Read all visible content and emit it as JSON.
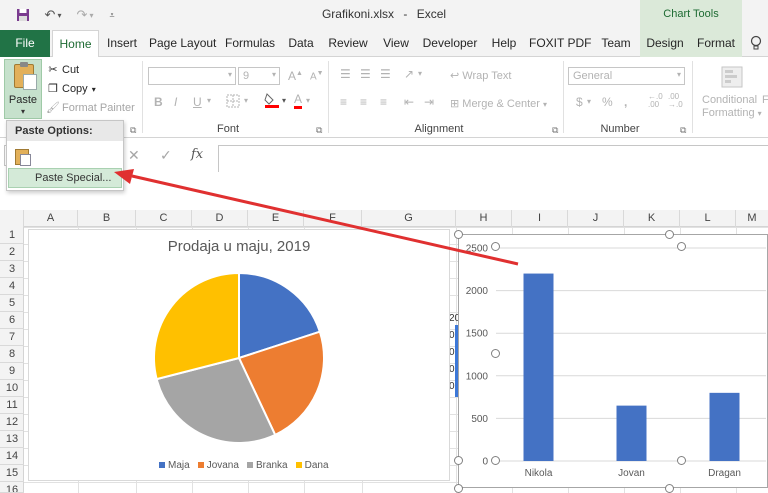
{
  "window": {
    "file_name": "Grafikoni.xlsx",
    "separator": "-",
    "app_name": "Excel",
    "contextual_group": "Chart Tools"
  },
  "qat": {
    "icons": [
      "save-icon",
      "undo-icon",
      "redo-icon",
      "customize-qat-icon"
    ]
  },
  "tabs": [
    {
      "label": "File"
    },
    {
      "label": "Home",
      "active": true
    },
    {
      "label": "Insert"
    },
    {
      "label": "Page Layout"
    },
    {
      "label": "Formulas"
    },
    {
      "label": "Data"
    },
    {
      "label": "Review"
    },
    {
      "label": "View"
    },
    {
      "label": "Developer"
    },
    {
      "label": "Help"
    },
    {
      "label": "FOXIT PDF"
    },
    {
      "label": "Team"
    },
    {
      "label": "Design",
      "contextual": true
    },
    {
      "label": "Format",
      "contextual": true
    }
  ],
  "ribbon": {
    "clipboard": {
      "paste": "Paste",
      "cut": "Cut",
      "copy": "Copy",
      "format_painter": "Format Painter"
    },
    "font": {
      "label": "Font",
      "size": "9",
      "grow": "A",
      "shrink": "A",
      "bold": "B",
      "italic": "I",
      "underline": "U",
      "font_color": "A"
    },
    "alignment": {
      "label": "Alignment",
      "wrap_text": "Wrap Text",
      "merge_center": "Merge & Center"
    },
    "number": {
      "label": "Number",
      "format": "General",
      "currency": "$",
      "percent": "%",
      "comma": ","
    },
    "styles": {
      "conditional_formatting_1": "Conditional",
      "conditional_formatting_2": "Formatting",
      "cutoff": "F"
    }
  },
  "paste_menu": {
    "header": "Paste Options:",
    "paste_special": "Paste Special..."
  },
  "formula_bar": {
    "fx": "fx",
    "cancel": "✕",
    "enter": "✓"
  },
  "columns": [
    "A",
    "B",
    "C",
    "D",
    "E",
    "F",
    "G",
    "H",
    "I",
    "J",
    "K",
    "L",
    "M"
  ],
  "rows": [
    "1",
    "2",
    "3",
    "4",
    "5",
    "6",
    "7",
    "8",
    "9",
    "10",
    "11",
    "12",
    "13",
    "14",
    "15",
    "16"
  ],
  "partial_cells": [
    "20",
    "0",
    "0",
    "0",
    "0"
  ],
  "colors": {
    "excel_green": "#217346",
    "arrow_red": "#e03030",
    "bar_blue": "#4472c4",
    "pie": [
      "#4472c4",
      "#ed7d31",
      "#a5a5a5",
      "#ffc000"
    ]
  },
  "chart_data": [
    {
      "type": "pie",
      "title": "Prodaja u maju, 2019",
      "categories": [
        "Maja",
        "Jovana",
        "Branka",
        "Dana"
      ],
      "values": [
        20,
        23,
        28,
        29
      ],
      "colors": [
        "#4472c4",
        "#ed7d31",
        "#a5a5a5",
        "#ffc000"
      ],
      "legend": "bottom"
    },
    {
      "type": "bar",
      "title": "",
      "categories": [
        "Nikola",
        "Jovan",
        "Dragan"
      ],
      "values": [
        2200,
        650,
        800
      ],
      "ylim": [
        0,
        2500
      ],
      "yticks": [
        0,
        500,
        1000,
        1500,
        2000,
        2500
      ],
      "grid": true,
      "color": "#4472c4"
    }
  ]
}
